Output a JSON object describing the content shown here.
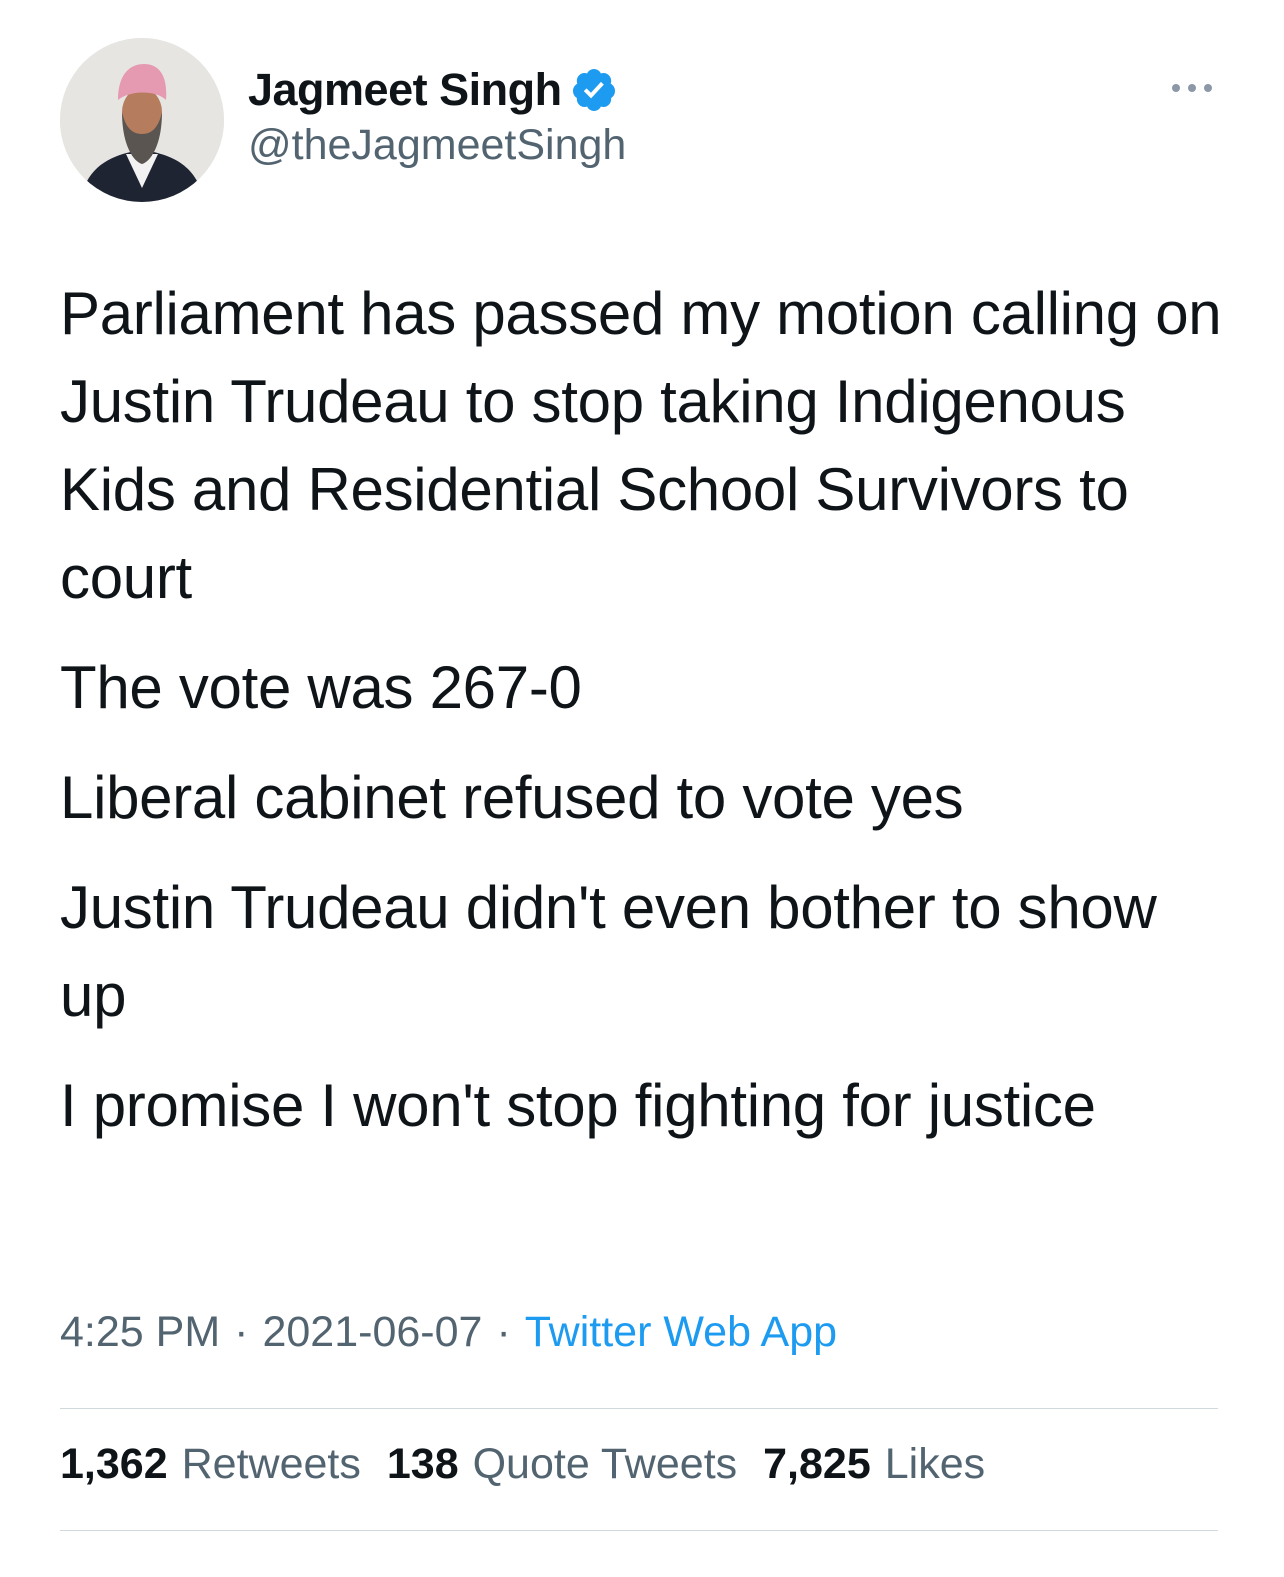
{
  "author": {
    "display_name": "Jagmeet Singh",
    "handle": "@theJagmeetSingh",
    "avatar_icon": "profile-photo",
    "verified_icon": "verified-badge-icon",
    "verified_color": "#1d9bf0"
  },
  "more_icon": "more-options-icon",
  "tweet": {
    "paragraphs": [
      "Parliament has passed my motion calling on Justin Trudeau to stop taking Indigenous Kids and Residential School Survivors to court",
      "The vote was 267-0",
      "Liberal cabinet refused to vote yes",
      "Justin Trudeau didn't even bother to show up",
      "I promise I won't stop fighting for justice"
    ]
  },
  "meta": {
    "time": "4:25 PM",
    "separator": "·",
    "date": "2021-06-07",
    "source": "Twitter Web App"
  },
  "stats": {
    "retweets_count": "1,362",
    "retweets_label": "Retweets",
    "quotes_count": "138",
    "quotes_label": "Quote Tweets",
    "likes_count": "7,825",
    "likes_label": "Likes"
  },
  "colors": {
    "text": "#0f1419",
    "secondary": "#536471",
    "link": "#1d9bf0",
    "divider": "#cfd9de"
  }
}
